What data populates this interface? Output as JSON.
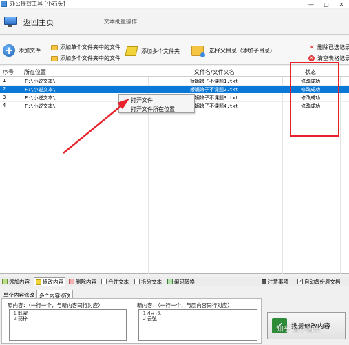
{
  "window": {
    "title": "办公提效工具 [小石头]",
    "controls": [
      "—",
      "□",
      "✕"
    ]
  },
  "nav": {
    "back_label": "返回主页",
    "page_subtitle": "文本批量操作"
  },
  "toolbar": {
    "add_file": "添加文件",
    "add_single_folder_files": "添加单个文件夹中的文件",
    "add_multi_folder_files": "添加多个文件夹中的文件",
    "add_multi_folders": "添加多个文件夹",
    "select_parent_dir": "选择父目录（添加子目录）",
    "delete_selected": "删除已选记录",
    "clear_table": "清空表格记录"
  },
  "table": {
    "headers": {
      "index": "序号",
      "location": "所在位置",
      "name": "文件名/文件夹名",
      "status": "状态"
    },
    "rows": [
      {
        "index": "1",
        "location": "F:\\小说文本\\",
        "name": "娇媚娘子不课题1.txt",
        "status": "修改成功"
      },
      {
        "index": "2",
        "location": "F:\\小说文本\\",
        "name": "娇媚娘子不课题2.txt",
        "status": "修改成功"
      },
      {
        "index": "3",
        "location": "F:\\小说文本\\",
        "name": "娇媚娘子不课题3.txt",
        "status": "修改成功"
      },
      {
        "index": "4",
        "location": "F:\\小说文本\\",
        "name": "娇媚娘子不课题4.txt",
        "status": "修改成功"
      }
    ]
  },
  "context_menu": {
    "open_file": "打开文件",
    "open_location": "打开文件所在位置"
  },
  "bottom_tabs": {
    "add_content": "添加内容",
    "modify_content": "修改内容",
    "delete_content": "删除内容",
    "merge_text": "合并文本",
    "split_text": "拆分文本",
    "encoding_convert": "编码转换",
    "notes": "注意事项",
    "auto_backup": "自动备份原文档"
  },
  "subtabs": {
    "single": "单个内容修改",
    "multi": "多个内容修改"
  },
  "panel": {
    "original_label": "原内容：（一行一个，与新内容同行对应）",
    "new_label": "新内容：（一行一个，与原内容同行对应）",
    "original_lines": [
      {
        "n": "1",
        "text": "既濯"
      },
      {
        "n": "2",
        "text": "琵梓"
      }
    ],
    "new_lines": [
      {
        "n": "1",
        "text": "小石头"
      },
      {
        "n": "2",
        "text": "云弦"
      }
    ]
  },
  "execute_button": "批量修改内容",
  "watermark": "知乎 @小石头",
  "colors": {
    "selection": "#0a78d7",
    "highlight_box": "#e8222a",
    "arrow": "#e8222a"
  }
}
